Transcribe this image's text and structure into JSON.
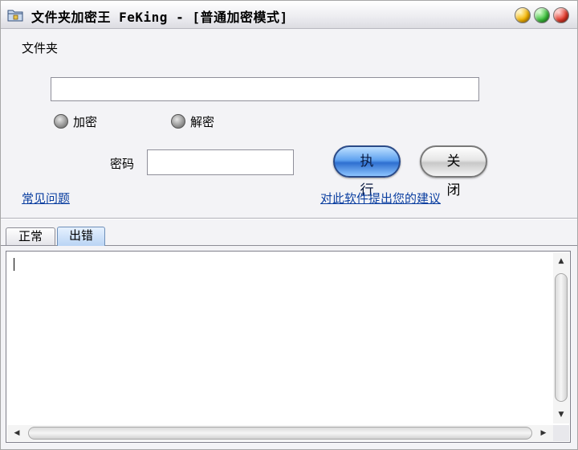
{
  "window": {
    "title": "文件夹加密王 FeKing - [普通加密模式]"
  },
  "form": {
    "folder_label": "文件夹",
    "folder_value": "",
    "mode_options": [
      "加密",
      "解密"
    ],
    "password_label": "密码",
    "password_value": "",
    "execute_label": "执行",
    "close_label": "关闭"
  },
  "links": {
    "faq": "常见问题",
    "suggestion": "对此软件提出您的建议"
  },
  "tabs": [
    {
      "label": "正常"
    },
    {
      "label": "出错"
    }
  ],
  "log": {
    "content": ""
  },
  "colors": {
    "execute_button": "#2e6fd0",
    "link": "#0a3ea0",
    "active_tab": "#b9d4f4"
  }
}
